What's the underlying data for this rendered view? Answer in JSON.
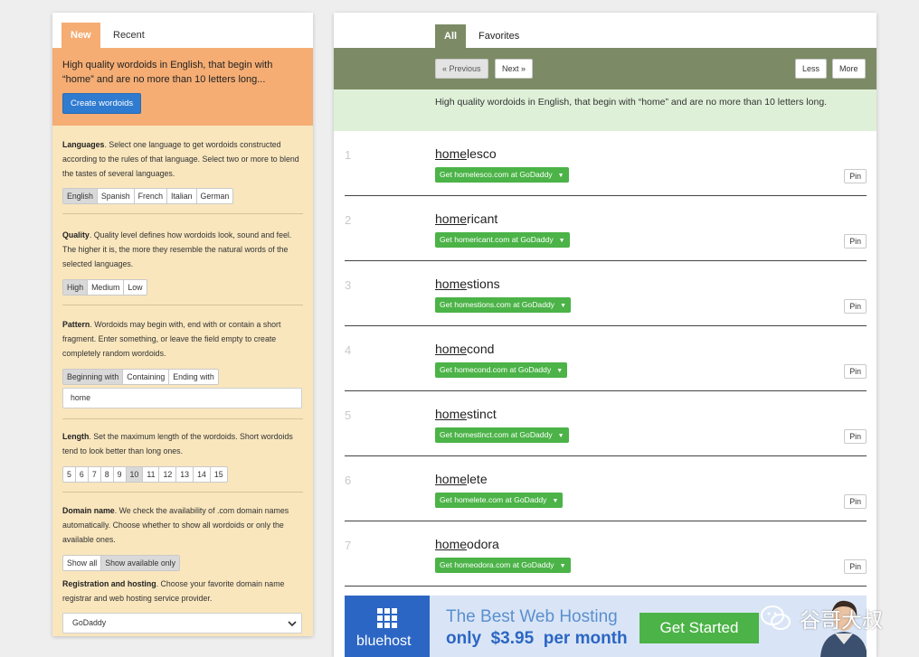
{
  "left": {
    "tabs": {
      "new": "New",
      "recent": "Recent"
    },
    "hero": {
      "text": "High quality wordoids in English, that begin with “home” and are no more than 10 letters long...",
      "button": "Create wordoids"
    },
    "languages": {
      "title": "Languages",
      "desc": ". Select one language to get wordoids constructed according to the rules of that language. Select two or more to blend the tastes of several languages.",
      "options": [
        "English",
        "Spanish",
        "French",
        "Italian",
        "German"
      ],
      "selected": "English"
    },
    "quality": {
      "title": "Quality",
      "desc": ". Quality level defines how wordoids look, sound and feel. The higher it is, the more they resemble the natural words of the selected languages.",
      "options": [
        "High",
        "Medium",
        "Low"
      ],
      "selected": "High"
    },
    "pattern": {
      "title": "Pattern",
      "desc": ". Wordoids may begin with, end with or contain a short fragment. Enter something, or leave the field empty to create completely random wordoids.",
      "options": [
        "Beginning with",
        "Containing",
        "Ending with"
      ],
      "selected": "Beginning with",
      "value": "home"
    },
    "length": {
      "title": "Length",
      "desc": ". Set the maximum length of the wordoids. Short wordoids tend to look better than long ones.",
      "options": [
        "5",
        "6",
        "7",
        "8",
        "9",
        "10",
        "11",
        "12",
        "13",
        "14",
        "15"
      ],
      "selected": "10"
    },
    "domain": {
      "title": "Domain name",
      "desc": ". We check the availability of .com domain names automatically. Choose whether to show all wordoids or only the available ones.",
      "options": [
        "Show all",
        "Show available only"
      ],
      "selected": "Show available only"
    },
    "registration": {
      "title": "Registration and hosting",
      "desc": ". Choose your favorite domain name registrar and web hosting service provider.",
      "value": "GoDaddy"
    }
  },
  "right": {
    "tabs": {
      "all": "All",
      "favorites": "Favorites"
    },
    "nav": {
      "previous": "« Previous",
      "next": "Next »",
      "less": "Less",
      "more": "More"
    },
    "description": "High quality wordoids in English, that begin with “home” and are no more than 10 letters long.",
    "pin_label": "Pin",
    "results": [
      {
        "num": "1",
        "prefix": "home",
        "rest": "lesco",
        "button": "Get homelesco.com at GoDaddy"
      },
      {
        "num": "2",
        "prefix": "home",
        "rest": "ricant",
        "button": "Get homericant.com at GoDaddy"
      },
      {
        "num": "3",
        "prefix": "home",
        "rest": "stions",
        "button": "Get homestions.com at GoDaddy"
      },
      {
        "num": "4",
        "prefix": "home",
        "rest": "cond",
        "button": "Get homecond.com at GoDaddy"
      },
      {
        "num": "5",
        "prefix": "home",
        "rest": "stinct",
        "button": "Get homestinct.com at GoDaddy"
      },
      {
        "num": "6",
        "prefix": "home",
        "rest": "lete",
        "button": "Get homelete.com at GoDaddy"
      },
      {
        "num": "7",
        "prefix": "home",
        "rest": "odora",
        "button": "Get homeodora.com at GoDaddy"
      }
    ],
    "ad": {
      "brand": "bluehost",
      "headline": "The Best Web Hosting",
      "price": "only  $3.95  per month",
      "cta": "Get Started"
    }
  },
  "watermark": {
    "text": "谷哥大叔",
    "icon": "wechat-icon"
  },
  "colors": {
    "orange": "#f5ad74",
    "cream": "#f9e6bd",
    "olive": "#7c8b65",
    "green": "#4bb347",
    "blue": "#2f7bd0",
    "mint": "#dff0d8"
  }
}
